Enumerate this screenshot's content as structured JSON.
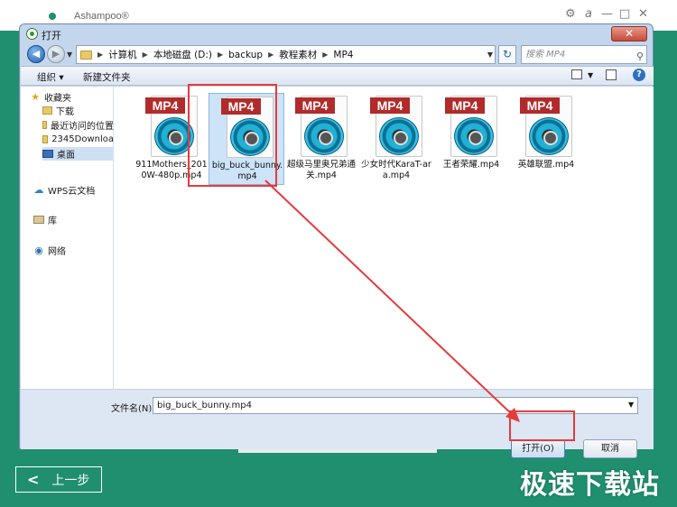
{
  "app": {
    "name": "Ashampoo®",
    "back_button": "上一步",
    "controls": [
      "⚙",
      "a",
      "—",
      "□",
      "✕"
    ]
  },
  "watermark": "极速下载站",
  "dialog": {
    "title": "打开",
    "close_label": "✕",
    "breadcrumbs": [
      "计算机",
      "本地磁盘 (D:)",
      "backup",
      "教程素材",
      "MP4"
    ],
    "search_placeholder": "搜索 MP4",
    "organize_label": "组织 ▾",
    "new_folder_label": "新建文件夹",
    "nav": {
      "favorites": "收藏夹",
      "downloads": "下载",
      "recent": "最近访问的位置",
      "downloads2345": "2345Downloa",
      "desktop": "桌面",
      "wps_cloud": "WPS云文档",
      "library": "库",
      "network": "网络"
    },
    "file_badge": "MP4",
    "files": [
      {
        "name": "911Mothers_2010W-480p.mp4",
        "selected": false
      },
      {
        "name": "big_buck_bunny.mp4",
        "selected": true
      },
      {
        "name": "超级马里奥兄弟通关.mp4",
        "selected": false
      },
      {
        "name": "少女时代KaraT-ara.mp4",
        "selected": false
      },
      {
        "name": "王者荣耀.mp4",
        "selected": false
      },
      {
        "name": "英雄联盟.mp4",
        "selected": false
      }
    ],
    "filename_label": "文件名(N):",
    "filename_value": "big_buck_bunny.mp4",
    "open_button": "打开(O)",
    "cancel_button": "取消"
  },
  "colors": {
    "app_green": "#1f8f6f",
    "annotation_red": "#e53b3b",
    "mp4_badge": "#b12b2b",
    "selection": "#cde3f8"
  }
}
